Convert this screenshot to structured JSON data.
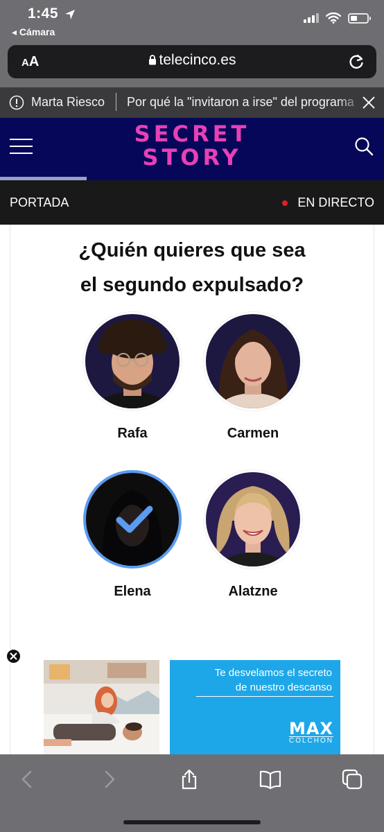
{
  "status_bar": {
    "time": "1:45",
    "back_app": "◂ Cámara",
    "battery_level": 0.3
  },
  "address_bar": {
    "aa_small": "A",
    "aa_big": "A",
    "url": "telecinco.es"
  },
  "ticker": {
    "name": "Marta Riesco",
    "headline": "Por qué la \"invitaron a irse\" del programa"
  },
  "site": {
    "logo_line1": "SECRET",
    "logo_line2": "STORY",
    "brand_color": "#e940b5",
    "header_color": "#07075a"
  },
  "subnav": {
    "left": "PORTADA",
    "right": "EN DIRECTO"
  },
  "poll": {
    "question_line1": "¿Quién quieres que sea",
    "question_line2": "el segundo expulsado?",
    "candidates": [
      {
        "name": "Rafa",
        "selected": false
      },
      {
        "name": "Carmen",
        "selected": false
      },
      {
        "name": "Elena",
        "selected": true
      },
      {
        "name": "Alatzne",
        "selected": false
      }
    ]
  },
  "ad": {
    "text_line1": "Te desvelamos el secreto",
    "text_line2": "de nuestro descanso",
    "brand_big": "MAX",
    "brand_small": "COLCHON",
    "panel_color": "#1ea7e8"
  },
  "toolbar": {
    "icons": [
      "back-arrow-icon",
      "forward-arrow-icon",
      "share-icon",
      "bookmarks-icon",
      "tabs-icon"
    ]
  }
}
